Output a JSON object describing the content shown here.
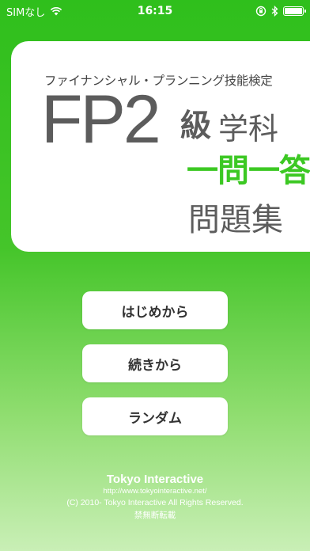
{
  "status_bar": {
    "carrier": "SIMなし",
    "time": "16:15",
    "battery_level": 1.0,
    "icons": [
      "wifi-icon",
      "orientation-lock-icon",
      "bluetooth-icon",
      "battery-icon"
    ]
  },
  "title": {
    "subtitle": "ファイナンシャル・プランニング技能検定",
    "fp2": "FP2",
    "kyu": "級",
    "gakka": "学科",
    "ichimon": "一問一答",
    "mondai": "問題集"
  },
  "menu": {
    "start_label": "はじめから",
    "continue_label": "続きから",
    "random_label": "ランダム"
  },
  "footer": {
    "brand": "Tokyo Interactive",
    "url": "http://www.tokyointeractive.net/",
    "copyright": "(C) 2010- Tokyo Interactive All Rights Reserved.",
    "note": "禁無断転載"
  },
  "colors": {
    "accent_green": "#3cc823",
    "title_gray": "#5c5c5c"
  }
}
